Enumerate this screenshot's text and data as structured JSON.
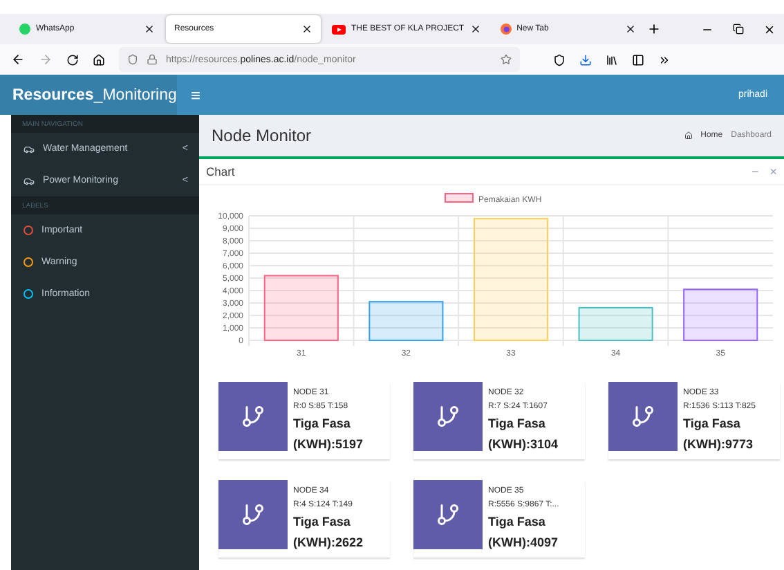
{
  "browser": {
    "tabs": [
      {
        "label": "WhatsApp",
        "kind": "whatsapp",
        "selected": false
      },
      {
        "label": "Resources",
        "kind": "plain",
        "selected": true
      },
      {
        "label": "THE BEST OF KLA PROJECT",
        "kind": "youtube",
        "selected": false
      },
      {
        "label": "New Tab",
        "kind": "firefox",
        "selected": false
      }
    ],
    "url_prefix": "https://resources.",
    "url_domain": "polines.ac.id",
    "url_path": "/node_monitor"
  },
  "app": {
    "brand_bold": "Resources",
    "brand_rest": "_Monitoring",
    "menu_glyph": "≡",
    "user": "prihadi"
  },
  "sidebar": {
    "sections": [
      {
        "header": "MAIN NAVIGATION",
        "items": [
          {
            "label": "Water Management",
            "kind": "nav",
            "glyph": "<"
          },
          {
            "label": "Power Monitoring",
            "kind": "nav",
            "glyph": "<"
          }
        ]
      },
      {
        "header": "LABELS",
        "items": [
          {
            "label": "Important",
            "kind": "label",
            "color": "#dd4b39"
          },
          {
            "label": "Warning",
            "kind": "label",
            "color": "#f39c12"
          },
          {
            "label": "Information",
            "kind": "label",
            "color": "#00c0ef"
          }
        ]
      }
    ]
  },
  "page": {
    "title": "Node Monitor",
    "breadcrumb": [
      "Home",
      "Dashboard"
    ]
  },
  "chart_box": {
    "title": "Chart",
    "tools": [
      "−",
      "×"
    ],
    "bars": [
      {
        "color": "#ff6384"
      },
      {
        "color": "#36a2eb"
      },
      {
        "color": "#ffce56"
      },
      {
        "color": "#4bc0c0"
      },
      {
        "color": "#9966ff"
      }
    ],
    "chart_data": {
      "type": "bar",
      "categories": [
        "31",
        "32",
        "33",
        "34",
        "35"
      ],
      "series": [
        {
          "name": "Pemakaian KWH",
          "values": [
            5197,
            3104,
            9773,
            2622,
            4097
          ]
        }
      ],
      "grid": true,
      "ylim": [
        0,
        10000
      ],
      "yticks": [
        {
          "value": 0,
          "label": "0"
        },
        {
          "value": 1000,
          "label": "1,000"
        },
        {
          "value": 2000,
          "label": "2,000"
        },
        {
          "value": 3000,
          "label": "3,000"
        },
        {
          "value": 4000,
          "label": "4,000"
        },
        {
          "value": 5000,
          "label": "5,000"
        },
        {
          "value": 6000,
          "label": "6,000"
        },
        {
          "value": 7000,
          "label": "7,000"
        },
        {
          "value": 8000,
          "label": "8,000"
        },
        {
          "value": 9000,
          "label": "9,000"
        },
        {
          "value": 10000,
          "label": "10,000"
        }
      ]
    }
  },
  "nodes": [
    {
      "name": "NODE 31",
      "rst": "R:0 S:85 T:158",
      "label": "Tiga Fasa",
      "value": "(KWH):5197"
    },
    {
      "name": "NODE 32",
      "rst": "R:7 S:24 T:1607",
      "label": "Tiga Fasa",
      "value": "(KWH):3104"
    },
    {
      "name": "NODE 33",
      "rst": "R:1536 S:113 T:825",
      "label": "Tiga Fasa",
      "value": "(KWH):9773"
    },
    {
      "name": "NODE 34",
      "rst": "R:4 S:124 T:149",
      "label": "Tiga Fasa",
      "value": "(KWH):2622"
    },
    {
      "name": "NODE 35",
      "rst": "R:5556 S:9867 T:...",
      "label": "Tiga Fasa",
      "value": "(KWH):4097"
    }
  ]
}
